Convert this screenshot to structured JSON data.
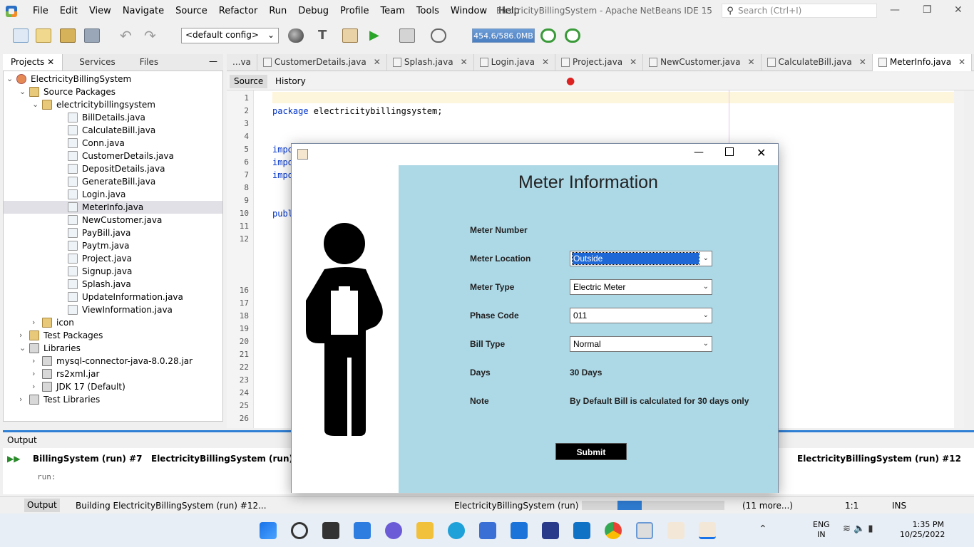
{
  "menubar": {
    "items": [
      "File",
      "Edit",
      "View",
      "Navigate",
      "Source",
      "Refactor",
      "Run",
      "Debug",
      "Profile",
      "Team",
      "Tools",
      "Window",
      "Help"
    ],
    "title": "ElectricityBillingSystem - Apache NetBeans IDE 15",
    "search_placeholder": "Search (Ctrl+I)"
  },
  "toolbar": {
    "config": "<default config>",
    "memory": "454.6/586.0MB"
  },
  "left_panel": {
    "tabs": [
      "Projects",
      "Services",
      "Files"
    ],
    "tree": [
      {
        "label": "ElectricityBillingSystem",
        "kind": "project"
      },
      {
        "label": "Source Packages",
        "kind": "package"
      },
      {
        "label": "electricitybillingsystem",
        "kind": "package"
      },
      {
        "label": "BillDetails.java",
        "kind": "file"
      },
      {
        "label": "CalculateBill.java",
        "kind": "file"
      },
      {
        "label": "Conn.java",
        "kind": "file"
      },
      {
        "label": "CustomerDetails.java",
        "kind": "file"
      },
      {
        "label": "DepositDetails.java",
        "kind": "file"
      },
      {
        "label": "GenerateBill.java",
        "kind": "file"
      },
      {
        "label": "Login.java",
        "kind": "file"
      },
      {
        "label": "MeterInfo.java",
        "kind": "file"
      },
      {
        "label": "NewCustomer.java",
        "kind": "file"
      },
      {
        "label": "PayBill.java",
        "kind": "file"
      },
      {
        "label": "Paytm.java",
        "kind": "file"
      },
      {
        "label": "Project.java",
        "kind": "file"
      },
      {
        "label": "Signup.java",
        "kind": "file"
      },
      {
        "label": "Splash.java",
        "kind": "file"
      },
      {
        "label": "UpdateInformation.java",
        "kind": "file"
      },
      {
        "label": "ViewInformation.java",
        "kind": "file"
      },
      {
        "label": "icon",
        "kind": "package"
      },
      {
        "label": "Test Packages",
        "kind": "package"
      },
      {
        "label": "Libraries",
        "kind": "library"
      },
      {
        "label": "mysql-connector-java-8.0.28.jar",
        "kind": "library"
      },
      {
        "label": "rs2xml.jar",
        "kind": "library"
      },
      {
        "label": "JDK 17 (Default)",
        "kind": "library"
      },
      {
        "label": "Test Libraries",
        "kind": "library"
      }
    ]
  },
  "editor": {
    "tabs": [
      "...va",
      "CustomerDetails.java",
      "Splash.java",
      "Login.java",
      "Project.java",
      "NewCustomer.java",
      "CalculateBill.java",
      "MeterInfo.java"
    ],
    "active_tab": "MeterInfo.java",
    "source_tab": "Source",
    "history_tab": "History",
    "line_numbers": [
      "1",
      "2",
      "3",
      "4",
      "5",
      "6",
      "7",
      "8",
      "9",
      "10",
      "11",
      "12",
      "",
      "",
      "",
      "16",
      "17",
      "18",
      "19",
      "20",
      "21",
      "22",
      "23",
      "24",
      "25",
      "26"
    ],
    "package_kw": "package",
    "package_name": " electricitybillingsystem;",
    "import_stub": "impo",
    "public_stub": "publ"
  },
  "output": {
    "title": "Output",
    "tabs": [
      "BillingSystem (run) #7",
      "ElectricityBillingSystem (run) #8",
      "ElectricityBillingSystem (run) #12"
    ],
    "console": "run:"
  },
  "statusbar": {
    "output_tab": "Output",
    "building": "Building ElectricityBillingSystem (run) #12...",
    "progress_label": "ElectricityBillingSystem (run) #12",
    "progress_fraction": 0.2,
    "more": "(11 more...)",
    "position": "1:1",
    "mode": "INS"
  },
  "taskbar": {
    "lang": "ENG",
    "region": "IN",
    "time": "1:35 PM",
    "date": "10/25/2022"
  },
  "dialog": {
    "heading": "Meter Information",
    "fields": [
      {
        "label": "Meter Number",
        "value": ""
      },
      {
        "label": "Meter Location",
        "value": "Outside",
        "type": "combo"
      },
      {
        "label": "Meter Type",
        "value": "Electric Meter",
        "type": "combo"
      },
      {
        "label": "Phase Code",
        "value": "011",
        "type": "combo"
      },
      {
        "label": "Bill Type",
        "value": "Normal",
        "type": "combo"
      },
      {
        "label": "Days",
        "value": "30 Days"
      },
      {
        "label": "Note",
        "value": "By Default Bill is calculated for 30 days only"
      }
    ],
    "submit": "Submit"
  }
}
